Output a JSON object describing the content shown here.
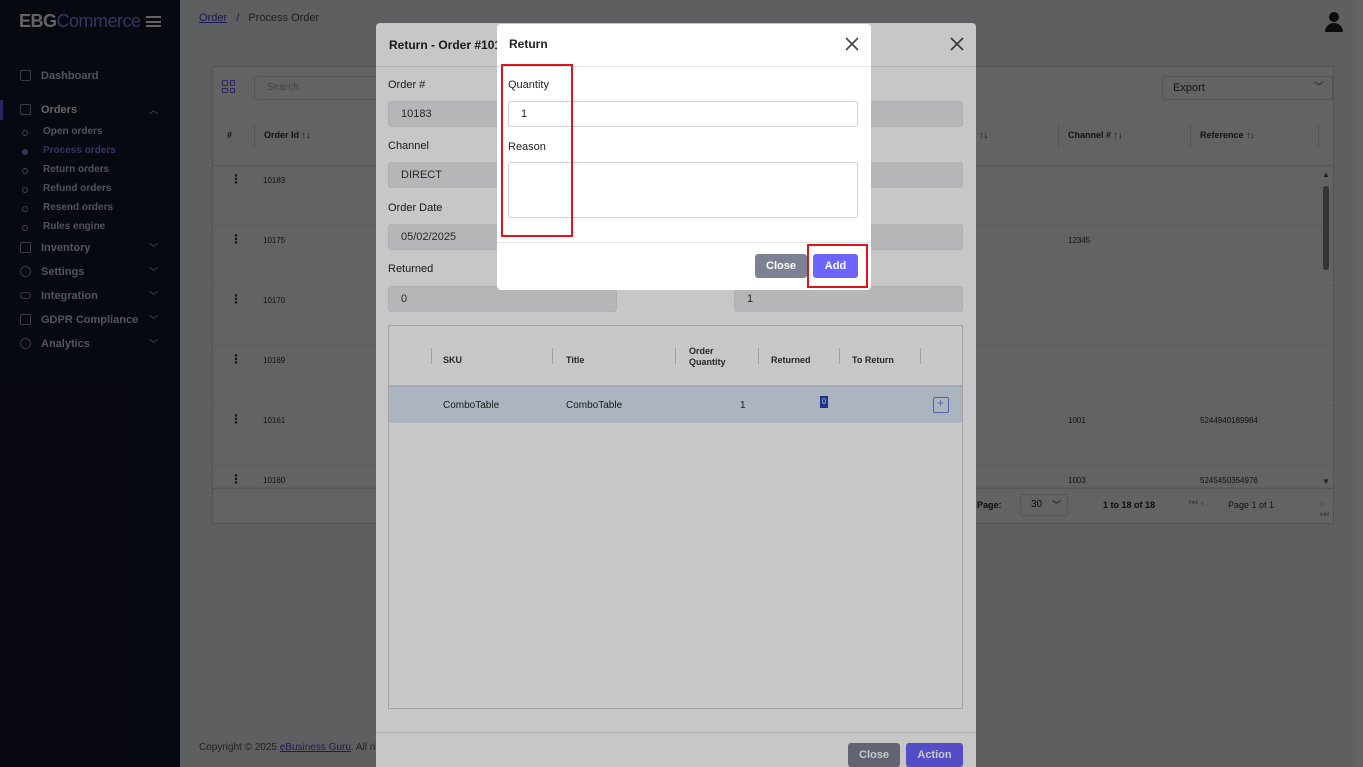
{
  "sidebar": {
    "logo_bold": "EBG",
    "logo_text": "Commerce",
    "items": [
      {
        "label": "Dashboard"
      },
      {
        "label": "Orders"
      },
      {
        "label": "Inventory"
      },
      {
        "label": "Settings"
      },
      {
        "label": "Integration"
      },
      {
        "label": "GDPR Compliance"
      },
      {
        "label": "Analytics"
      }
    ],
    "order_subitems": [
      {
        "label": "Open orders"
      },
      {
        "label": "Process orders"
      },
      {
        "label": "Return orders"
      },
      {
        "label": "Refund orders"
      },
      {
        "label": "Resend orders"
      },
      {
        "label": "Rules engine"
      }
    ]
  },
  "breadcrumb": {
    "link": "Order",
    "separator": "/",
    "current": "Process Order"
  },
  "toolbar": {
    "search_placeholder": "Search",
    "export_label": "Export"
  },
  "table": {
    "headers": {
      "hash": "#",
      "order_id": "Order Id",
      "channel_no": "Channel #",
      "reference": "Reference"
    },
    "rows": [
      {
        "order_id": "10183",
        "channel_no": "",
        "reference": ""
      },
      {
        "order_id": "10175",
        "channel_no": "12345",
        "reference": ""
      },
      {
        "order_id": "10170",
        "channel_no": "",
        "reference": ""
      },
      {
        "order_id": "10169",
        "channel_no": "",
        "reference": ""
      },
      {
        "order_id": "10161",
        "channel_no": "1001",
        "reference": "5244940189984"
      },
      {
        "order_id": "10160",
        "channel_no": "1003",
        "reference": "5245450354976"
      }
    ]
  },
  "pager": {
    "page_size_label": "Page:",
    "page_size": "30",
    "range": "1 to 18 of 18",
    "page_info": "Page 1 of 1"
  },
  "footer": {
    "text": "Copyright © 2025 ",
    "link": "eBusiness Guru",
    "rest": ". All ri"
  },
  "return_order_modal": {
    "title": "Return - Order #10183",
    "fields": {
      "order_no_label": "Order #",
      "order_no": "10183",
      "channel_label": "Channel",
      "channel": "DIRECT",
      "order_date_label": "Order Date",
      "order_date": "05/02/2025",
      "returned_label": "Returned",
      "returned": "0",
      "right_value": "1"
    },
    "items_table": {
      "headers": {
        "sku": "SKU",
        "title": "Title",
        "order_quantity": "Order Quantity",
        "returned": "Returned",
        "to_return": "To Return"
      },
      "rows": [
        {
          "sku": "ComboTable",
          "title": "ComboTable",
          "order_quantity": "1",
          "returned": "0"
        }
      ]
    },
    "close_label": "Close",
    "action_label": "Action"
  },
  "return_modal": {
    "title": "Return",
    "quantity_label": "Quantity",
    "quantity_value": "1",
    "reason_label": "Reason",
    "reason_value": "",
    "close_label": "Close",
    "add_label": "Add"
  },
  "colors": {
    "accent": "#6d63ff",
    "sidebar_bg": "#15182b",
    "highlight": "#e0141b",
    "selected_row": "#dce7f5"
  }
}
